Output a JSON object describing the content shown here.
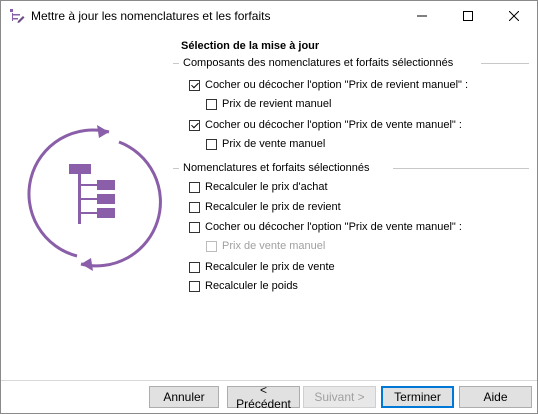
{
  "window": {
    "title": "Mettre à jour les nomenclatures et les forfaits",
    "accent_color": "#8a5ea8"
  },
  "main": {
    "heading": "Sélection de la mise à jour",
    "group1": {
      "title": "Composants des nomenclatures et forfaits sélectionnés",
      "options": [
        {
          "label": "Cocher ou décocher l'option \"Prix de revient manuel\" :",
          "checked": true
        },
        {
          "label": "Prix de revient manuel",
          "checked": false
        },
        {
          "label": "Cocher ou décocher l'option \"Prix de vente manuel\" :",
          "checked": true
        },
        {
          "label": "Prix de vente manuel",
          "checked": false
        }
      ]
    },
    "group2": {
      "title": "Nomenclatures et forfaits sélectionnés",
      "options": [
        {
          "label": "Recalculer le prix d'achat",
          "checked": false
        },
        {
          "label": "Recalculer le prix de revient",
          "checked": false
        },
        {
          "label": "Cocher ou décocher l'option \"Prix de vente manuel\" :",
          "checked": false
        },
        {
          "label": "Prix de vente manuel",
          "checked": false,
          "disabled": true
        },
        {
          "label": "Recalculer le prix de vente",
          "checked": false
        },
        {
          "label": "Recalculer le poids",
          "checked": false
        }
      ]
    }
  },
  "footer": {
    "cancel_label": "Annuler",
    "previous_label": "< Précédent",
    "next_label": "Suivant >",
    "finish_label": "Terminer",
    "help_label": "Aide"
  }
}
